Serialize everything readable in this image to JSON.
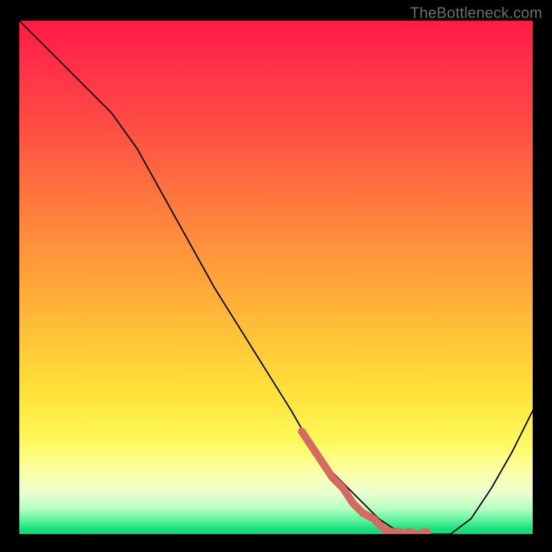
{
  "attribution": "TheBottleneck.com",
  "chart_data": {
    "type": "line",
    "title": "",
    "xlabel": "",
    "ylabel": "",
    "ylim": [
      0,
      100
    ],
    "xlim": [
      0,
      100
    ],
    "series": [
      {
        "name": "curve",
        "color": "#000000",
        "x": [
          0,
          6,
          12,
          18,
          23,
          28,
          33,
          38,
          43,
          48,
          53,
          57,
          60,
          63,
          66,
          68,
          70,
          73,
          76,
          80,
          84,
          88,
          92,
          96,
          100
        ],
        "y": [
          100,
          94,
          88,
          82,
          75,
          66,
          57,
          48,
          40,
          32,
          24,
          17,
          13,
          10,
          7,
          5,
          3,
          1,
          0,
          0,
          0,
          3,
          9,
          16,
          24
        ]
      },
      {
        "name": "highlight",
        "color": "#d66a63",
        "x": [
          55,
          57,
          59,
          61,
          63,
          65,
          67,
          69,
          71,
          74,
          76,
          79
        ],
        "y": [
          20,
          17,
          14,
          11,
          9,
          6,
          4,
          3,
          1,
          0,
          0,
          0
        ]
      }
    ],
    "markers": [
      {
        "name": "dot-a",
        "x": 74,
        "y": 0,
        "r": 1.4,
        "color": "#d66a63"
      },
      {
        "name": "dot-b",
        "x": 76,
        "y": 0,
        "r": 1.4,
        "color": "#d66a63"
      },
      {
        "name": "dot-c",
        "x": 79,
        "y": 0,
        "r": 1.4,
        "color": "#d66a63"
      }
    ]
  }
}
